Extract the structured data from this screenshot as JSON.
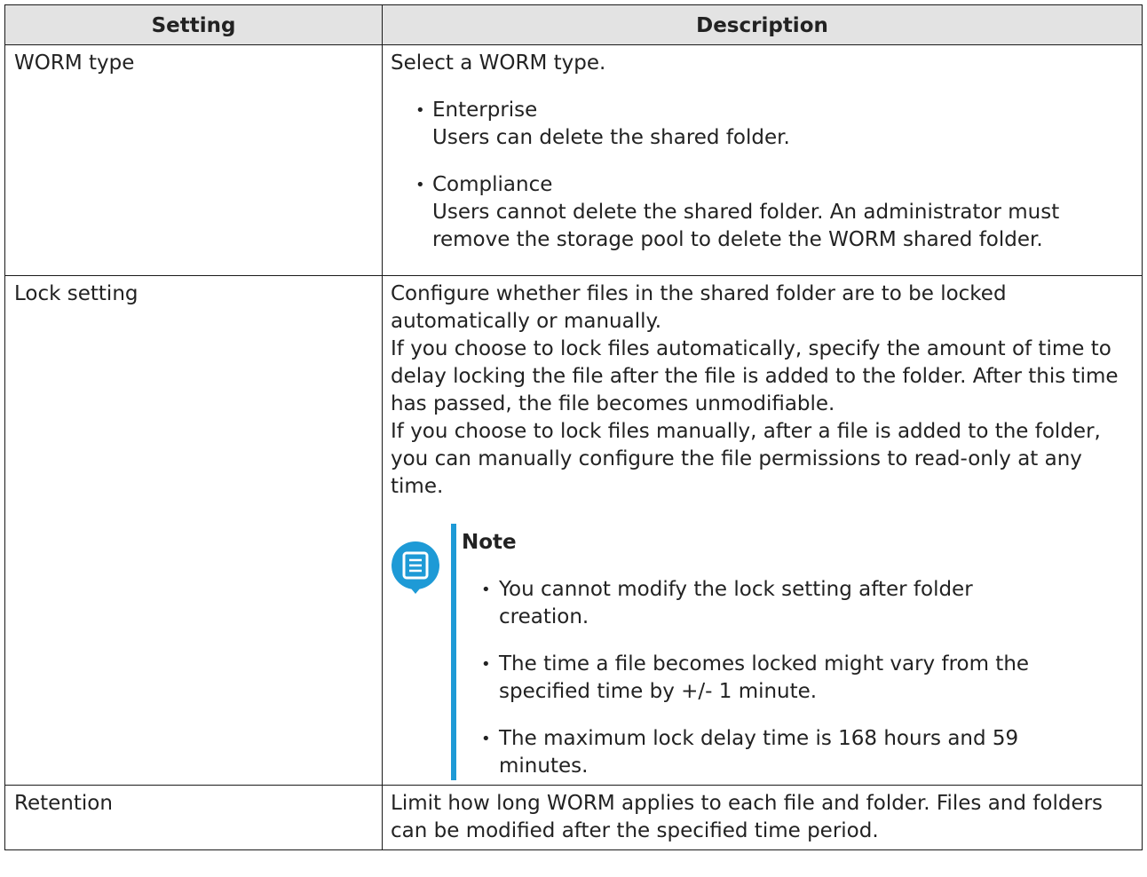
{
  "table": {
    "headers": [
      "Setting",
      "Description"
    ],
    "rows": [
      {
        "setting": "WORM type",
        "intro": "Select a WORM type.",
        "options": [
          {
            "name": "Enterprise",
            "text": "Users can delete the shared folder."
          },
          {
            "name": "Compliance",
            "text": "Users cannot delete the shared folder. An administrator must remove the storage pool to delete the WORM shared folder."
          }
        ]
      },
      {
        "setting": "Lock setting",
        "paragraphs": [
          "Configure whether files in the shared folder are to be locked automatically or manually.",
          "If you choose to lock files automatically, specify the amount of time to delay locking the file after the file is added to the folder. After this time has passed, the file becomes unmodifiable.",
          "If you choose to lock files manually, after a file is added to the folder, you can manually configure the file permissions to read-only at any time."
        ],
        "note": {
          "icon": "note-icon",
          "title": "Note",
          "items": [
            "You cannot modify the lock setting after folder creation.",
            "The time a file becomes locked might vary from the specified time by +/- 1 minute.",
            "The maximum lock delay time is 168 hours and 59 minutes."
          ]
        }
      },
      {
        "setting": "Retention",
        "paragraphs": [
          "Limit how long WORM applies to each file and folder. Files and folders can be modified after the specified time period."
        ]
      }
    ]
  },
  "colors": {
    "header_bg": "#e3e3e3",
    "border": "#1a1a1a",
    "note_accent": "#1e9ad6"
  }
}
